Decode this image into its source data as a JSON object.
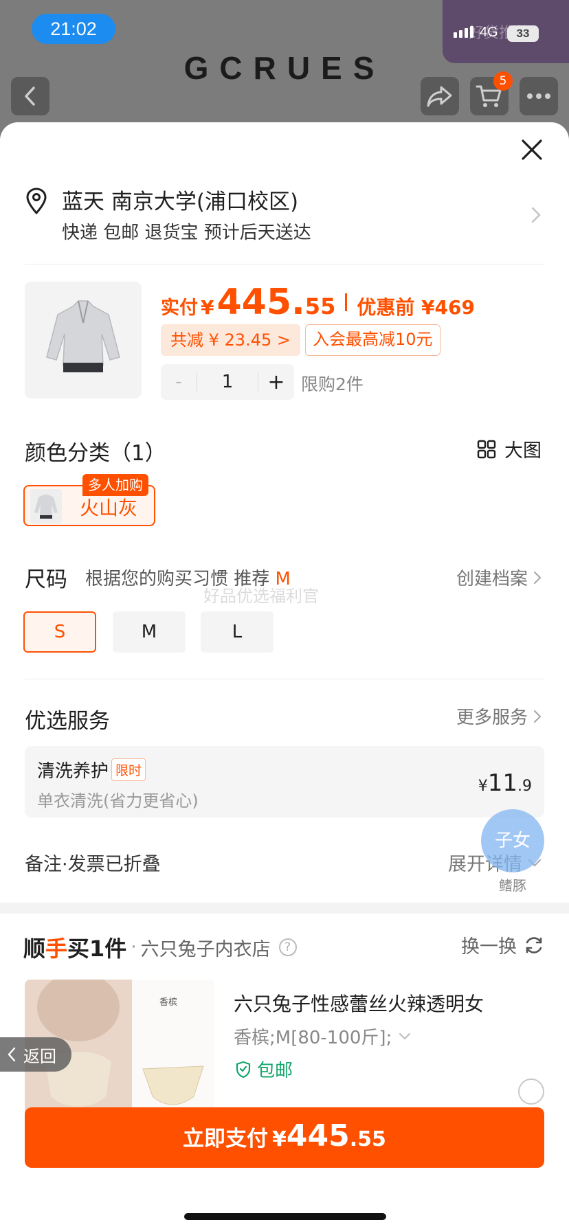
{
  "status_bar": {
    "time": "21:02",
    "network": "4G",
    "battery": "33",
    "overlay_watermark": "好货推荐"
  },
  "header": {
    "brand": "GCRUES",
    "cart_count": "5"
  },
  "address": {
    "recipient": "蓝天 南京大学(浦口校区)",
    "delivery": "快递 包邮 退货宝 预计后天送达"
  },
  "product": {
    "price_label": "实付",
    "currency": "¥",
    "price_int": "445.",
    "price_dec": "55",
    "original_price": "优惠前 ¥469",
    "discount_tag": "共减 ¥ 23.45 >",
    "member_tag": "入会最高减10元",
    "quantity": "1",
    "minus": "-",
    "plus": "+",
    "limit": "限购2件"
  },
  "color": {
    "title": "颜色分类（1）",
    "big_image": "大图",
    "option": "火山灰",
    "badge": "多人加购"
  },
  "size": {
    "title": "尺码",
    "hint": "根据您的购买习惯 推荐",
    "recommended": "M",
    "create_profile": "创建档案",
    "options": [
      "S",
      "M",
      "L"
    ],
    "selected": "S",
    "watermark": "好品优选福利官"
  },
  "services": {
    "title": "优选服务",
    "more": "更多服务",
    "item_name": "清洗养护",
    "item_tag": "限时",
    "item_desc": "单衣清洗(省力更省心)",
    "price_currency": "¥",
    "price_int": "11",
    "price_dec": ".9"
  },
  "remarks": {
    "label": "备注·发票已折叠",
    "expand": "展开详情"
  },
  "floating": {
    "bubble": "子女",
    "label": "鳍豚",
    "back": "返回"
  },
  "addon": {
    "logo_part1": "顺",
    "logo_part2": "手",
    "logo_part3": "买1件",
    "dot": "·",
    "shop": "六只兔子内衣店",
    "help": "?",
    "swap": "换一换",
    "product_name": "六只兔子性感蕾丝火辣透明女",
    "spec": "香槟;M[80-100斤];",
    "free_shipping": "包邮",
    "image_caption": "香槟"
  },
  "pay": {
    "label": "立即支付",
    "currency": "¥",
    "price_int": "445",
    "price_dec": ".55"
  },
  "colors": {
    "accent": "#ff5000",
    "green": "#11a56a",
    "status_pill": "#1d8cf0"
  }
}
